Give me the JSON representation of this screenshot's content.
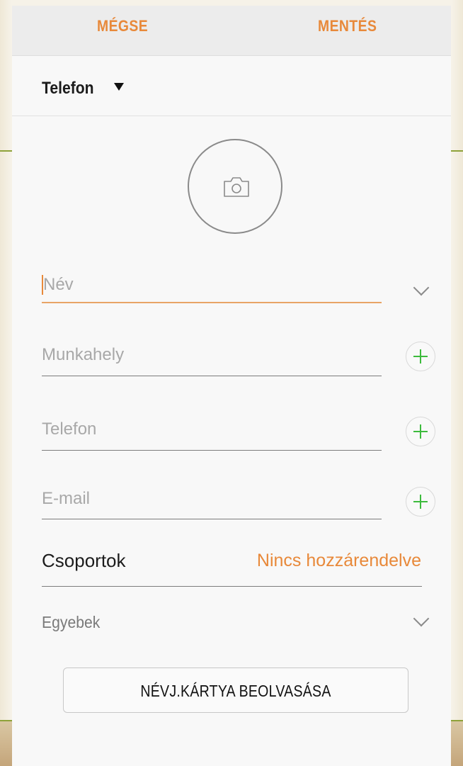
{
  "header": {
    "cancel_label": "MÉGSE",
    "save_label": "MENTÉS"
  },
  "account": {
    "label": "Telefon"
  },
  "photo": {
    "icon": "camera-icon"
  },
  "fields": {
    "name_placeholder": "Név",
    "company_placeholder": "Munkahely",
    "phone_placeholder": "Telefon",
    "email_placeholder": "E-mail"
  },
  "groups": {
    "label": "Csoportok",
    "value": "Nincs hozzárendelve"
  },
  "more": {
    "label": "Egyebek"
  },
  "scan_button": {
    "label": "NÉVJ.KÁRTYA BEOLVASÁSA"
  },
  "colors": {
    "accent": "#e8893a",
    "add": "#3dbb3d"
  }
}
